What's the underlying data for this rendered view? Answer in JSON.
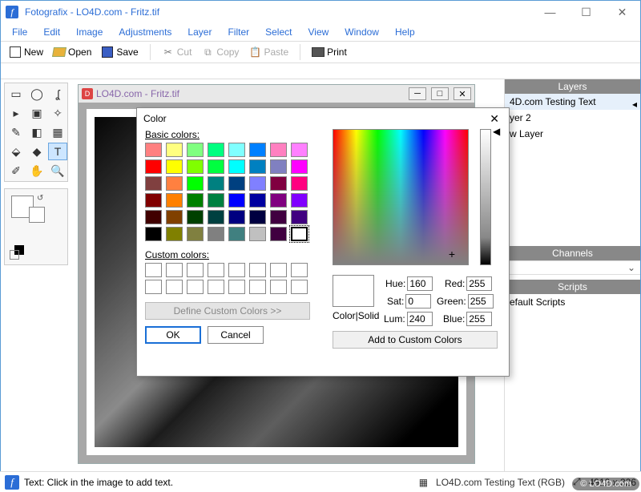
{
  "window": {
    "title": "Fotografix - LO4D.com - Fritz.tif"
  },
  "menu": [
    "File",
    "Edit",
    "Image",
    "Adjustments",
    "Layer",
    "Filter",
    "Select",
    "View",
    "Window",
    "Help"
  ],
  "toolbar": {
    "new": "New",
    "open": "Open",
    "save": "Save",
    "cut": "Cut",
    "copy": "Copy",
    "paste": "Paste",
    "print": "Print"
  },
  "doc": {
    "title": "LO4D.com - Fritz.tif"
  },
  "panels": {
    "layers_title": "Layers",
    "layers": [
      "4D.com Testing Text",
      "yer 2",
      "w Layer"
    ],
    "channels_title": "Channels",
    "scripts_title": "Scripts",
    "scripts": [
      "efault Scripts"
    ]
  },
  "status": {
    "text": "Text: Click in the image to add text.",
    "layer": "LO4D.com Testing Text (RGB)",
    "dims": "4912 x 326"
  },
  "dialog": {
    "title": "Color",
    "basic_label": "Basic colors:",
    "custom_label": "Custom colors:",
    "define": "Define Custom Colors >>",
    "ok": "OK",
    "cancel": "Cancel",
    "colorsolid": "Color|Solid",
    "hue_l": "Hue:",
    "sat_l": "Sat:",
    "lum_l": "Lum:",
    "red_l": "Red:",
    "green_l": "Green:",
    "blue_l": "Blue:",
    "hue": "160",
    "sat": "0",
    "lum": "240",
    "red": "255",
    "green": "255",
    "blue": "255",
    "add": "Add to Custom Colors",
    "basic_colors": [
      "#ff8080",
      "#ffff80",
      "#80ff80",
      "#00ff80",
      "#80ffff",
      "#0080ff",
      "#ff80c0",
      "#ff80ff",
      "#ff0000",
      "#ffff00",
      "#80ff00",
      "#00ff40",
      "#00ffff",
      "#0080c0",
      "#8080c0",
      "#ff00ff",
      "#804040",
      "#ff8040",
      "#00ff00",
      "#008080",
      "#004080",
      "#8080ff",
      "#800040",
      "#ff0080",
      "#800000",
      "#ff8000",
      "#008000",
      "#008040",
      "#0000ff",
      "#0000a0",
      "#800080",
      "#8000ff",
      "#400000",
      "#804000",
      "#004000",
      "#004040",
      "#000080",
      "#000040",
      "#400040",
      "#400080",
      "#000000",
      "#808000",
      "#808040",
      "#808080",
      "#408080",
      "#c0c0c0",
      "#400040",
      "#ffffff"
    ]
  },
  "watermark": "© LO4D.com"
}
